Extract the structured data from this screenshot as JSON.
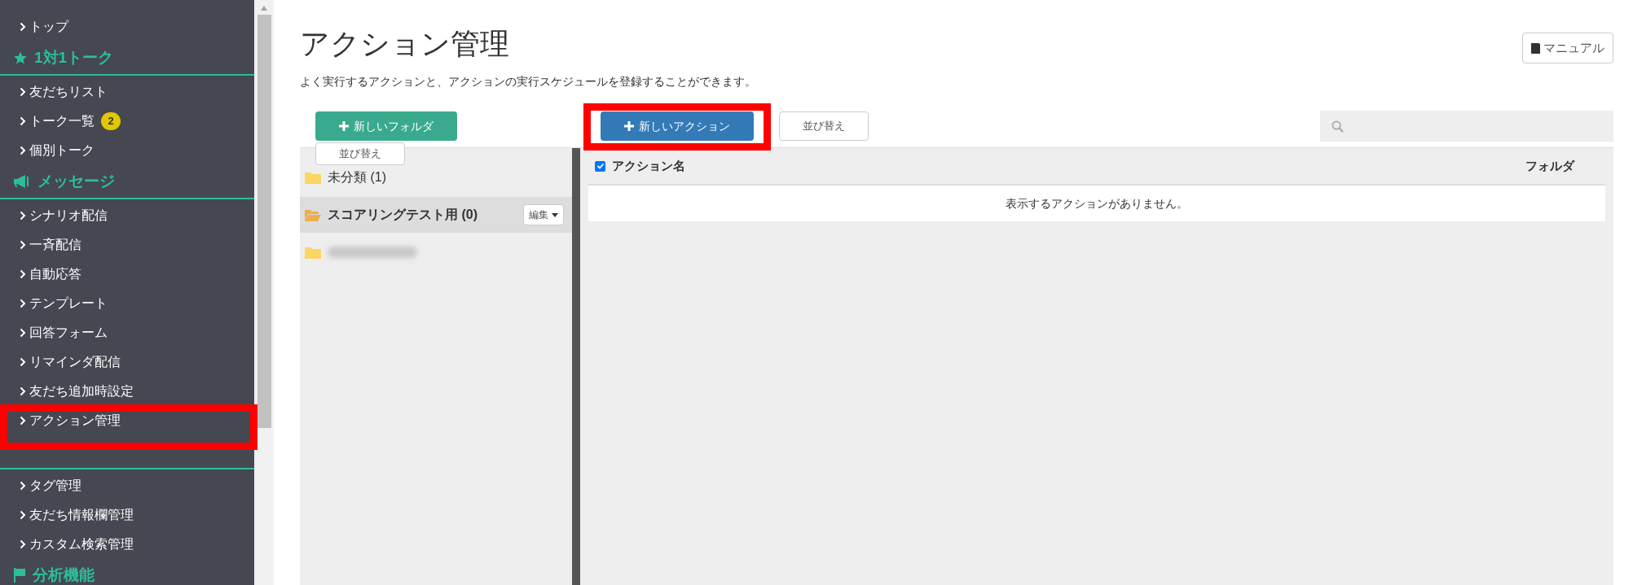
{
  "sidebar": [
    {
      "kind": "link",
      "label": "トップ",
      "highlighted": false
    },
    {
      "kind": "heading",
      "label": "1対1トーク"
    },
    {
      "kind": "link",
      "label": "友だちリスト",
      "highlighted": false
    },
    {
      "kind": "link",
      "label": "トーク一覧",
      "badge": "2",
      "highlighted": false
    },
    {
      "kind": "link",
      "label": "個別トーク",
      "highlighted": false
    },
    {
      "kind": "heading",
      "label": "メッセージ"
    },
    {
      "kind": "link",
      "label": "シナリオ配信",
      "highlighted": false
    },
    {
      "kind": "link",
      "label": "一斉配信",
      "highlighted": false
    },
    {
      "kind": "link",
      "label": "自動応答",
      "highlighted": false
    },
    {
      "kind": "link",
      "label": "テンプレート",
      "highlighted": false
    },
    {
      "kind": "link",
      "label": "回答フォーム",
      "highlighted": false
    },
    {
      "kind": "link",
      "label": "リマインダ配信",
      "highlighted": false
    },
    {
      "kind": "link",
      "label": "友だち追加時設定",
      "highlighted": false
    },
    {
      "kind": "link",
      "label": "アクション管理",
      "highlighted": true
    },
    {
      "kind": "heading"
    },
    {
      "kind": "link",
      "label": "タグ管理",
      "highlighted": false
    },
    {
      "kind": "link",
      "label": "友だち情報欄管理",
      "highlighted": false
    },
    {
      "kind": "link",
      "label": "カスタム検索管理",
      "highlighted": false
    },
    {
      "kind": "heading",
      "label": "分析機能"
    }
  ],
  "page": {
    "title": "アクション管理",
    "description": "よく実行するアクションと、アクションの実行スケジュールを登録することができます。",
    "manual_button": "マニュアル"
  },
  "folder_panel": {
    "new_button": "新しいフォルダ",
    "sort_popup": "並び替え",
    "folders": [
      {
        "label": "未分類 (1)",
        "selected": false
      },
      {
        "label": "スコアリングテスト用 (0)",
        "selected": true,
        "edit_button": "編集"
      },
      {
        "kind": "blurred",
        "selected": false
      }
    ]
  },
  "action_panel": {
    "new_button": {
      "label": "新しいアクション",
      "highlighted": true
    },
    "sort_button": "並び替え",
    "columns": [
      "アクション名",
      "フォルダ"
    ],
    "select_all": true,
    "empty_message": "表示するアクションがありません。"
  }
}
